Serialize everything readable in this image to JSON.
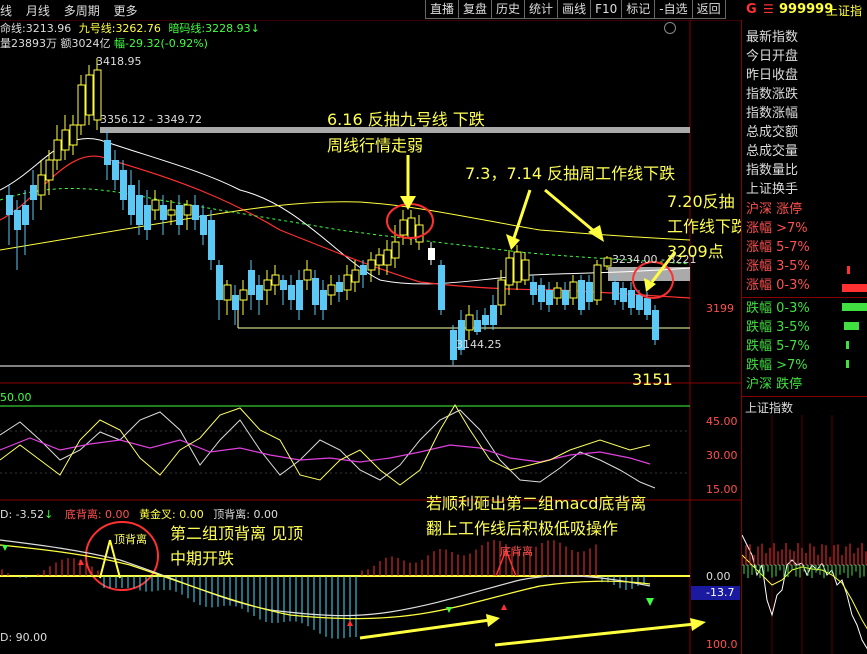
{
  "menu": {
    "items": [
      "线",
      "月线",
      "多周期",
      "更多"
    ],
    "buttons": [
      "直播",
      "复盘",
      "历史",
      "统计",
      "画线",
      "F10",
      "标记",
      "-自选",
      "返回"
    ]
  },
  "ticker": {
    "code": "999999",
    "name": "上证指",
    "flag": "G"
  },
  "indicators": {
    "line1_name": "命线:",
    "line1_val": "3213.96",
    "line2_name": "九号线:",
    "line2_val": "3262.76",
    "line3_name": "暗码线:",
    "line3_val": "3228.93",
    "vol_text": "量23893万 额3024亿",
    "change_text": "幅-29.32(-0.92%)"
  },
  "price_labels": {
    "high": "3418.95",
    "range": "3356.12 - 3349.72",
    "mid": "3234.00 - 3221",
    "low": "3144.25",
    "target": "3151",
    "axis_3199": "3199"
  },
  "osc": {
    "top_label": "50.00",
    "axis": [
      "45.00",
      "30.00",
      "15.00"
    ]
  },
  "macd": {
    "header": [
      "D: -3.52",
      "底背离: 0.00",
      "黄金叉: 0.00",
      "顶背离: 0.00"
    ],
    "axis_zero": "0.00",
    "value_box": "-13.7",
    "bottom_left": "D: 90.00",
    "axis_100": "100.0",
    "div_top": "顶背离",
    "div_bottom": "底背离"
  },
  "right_panel": {
    "items": [
      "最新指数",
      "今日开盘",
      "昨日收盘",
      "指数涨跌",
      "指数涨幅",
      "总成交额",
      "总成交量",
      "指数量比",
      "上证换手"
    ],
    "dist": [
      "沪深 涨停",
      "涨幅 >7%",
      "涨幅 5-7%",
      "涨幅 3-5%",
      "涨幅 0-3%",
      "跌幅 0-3%",
      "跌幅 3-5%",
      "跌幅 5-7%",
      "跌幅 >7%",
      "沪深 跌停"
    ],
    "mini_title": "上证指数"
  },
  "annotations": {
    "a1_line1": "6.16 反抽九号线 下跌",
    "a1_line2": "周线行情走弱",
    "a2": "7.3，7.14 反抽周工作线下跌",
    "a3_line1": "7.20反抽",
    "a3_line2": "工作线下跌",
    "a3_line3": "3209点",
    "a4_line1": "第二组顶背离 见顶",
    "a4_line2": "中期开跌",
    "a5_line1": "若顺利砸出第二组macd底背离",
    "a5_line2": "翻上工作线后积极低吸操作"
  }
}
